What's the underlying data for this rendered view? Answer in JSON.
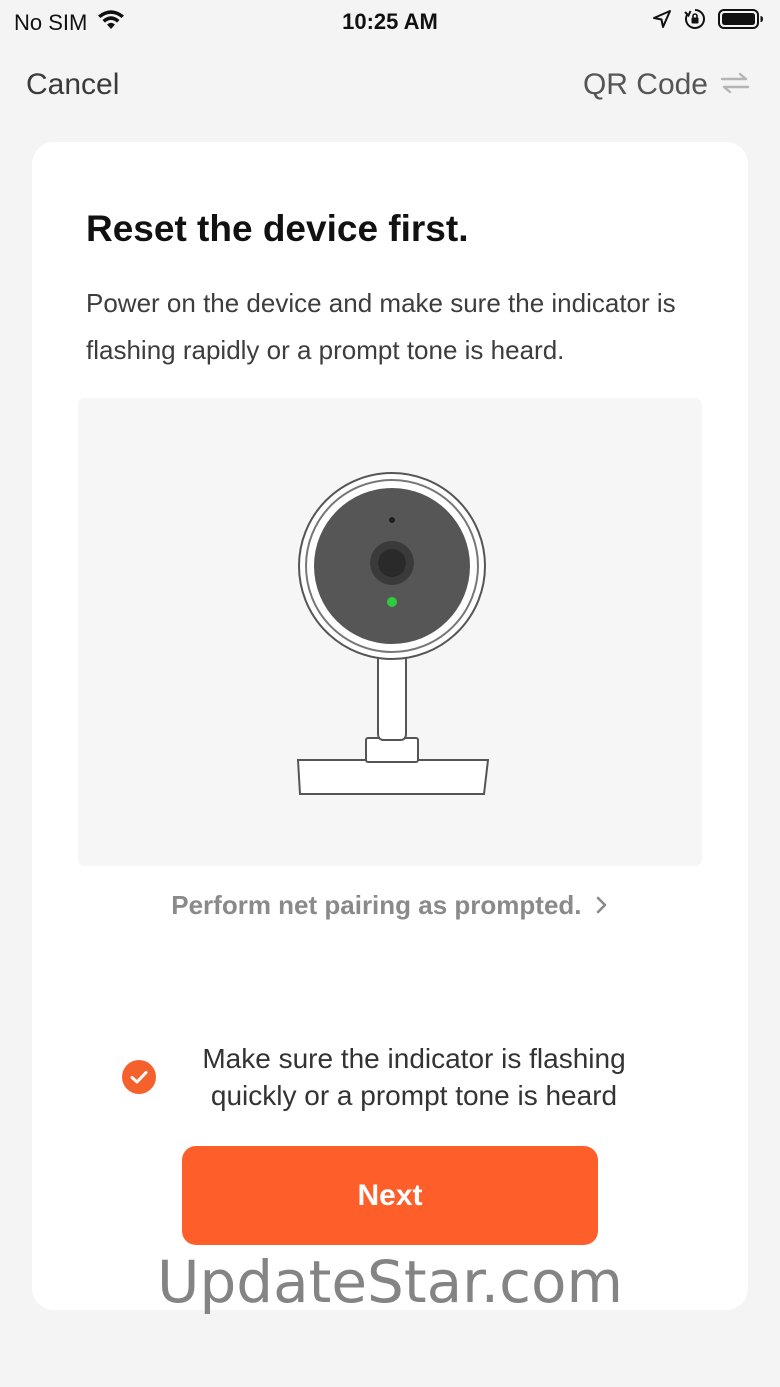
{
  "status_bar": {
    "carrier": "No SIM",
    "time": "10:25 AM",
    "icons": [
      "wifi-icon",
      "location-arrow-icon",
      "orientation-lock-icon",
      "battery-icon"
    ]
  },
  "nav": {
    "cancel_label": "Cancel",
    "qr_label": "QR Code",
    "qr_icon": "switch-arrows-icon"
  },
  "card": {
    "title": "Reset the device first.",
    "description": "Power on the device and make sure the indicator is flashing rapidly or a prompt tone is heard.",
    "illustration_icon": "camera-device-icon",
    "pairing_link": "Perform net pairing as prompted.",
    "pairing_link_icon": "chevron-right-icon",
    "confirm_text": "Make sure the indicator is flashing quickly or a prompt tone is heard",
    "confirm_checked": true,
    "next_label": "Next"
  },
  "colors": {
    "accent": "#fd5e2a",
    "indicator_led": "#2ecc40",
    "background": "#f4f4f4",
    "card": "#ffffff"
  },
  "watermark": "UpdateStar.com"
}
